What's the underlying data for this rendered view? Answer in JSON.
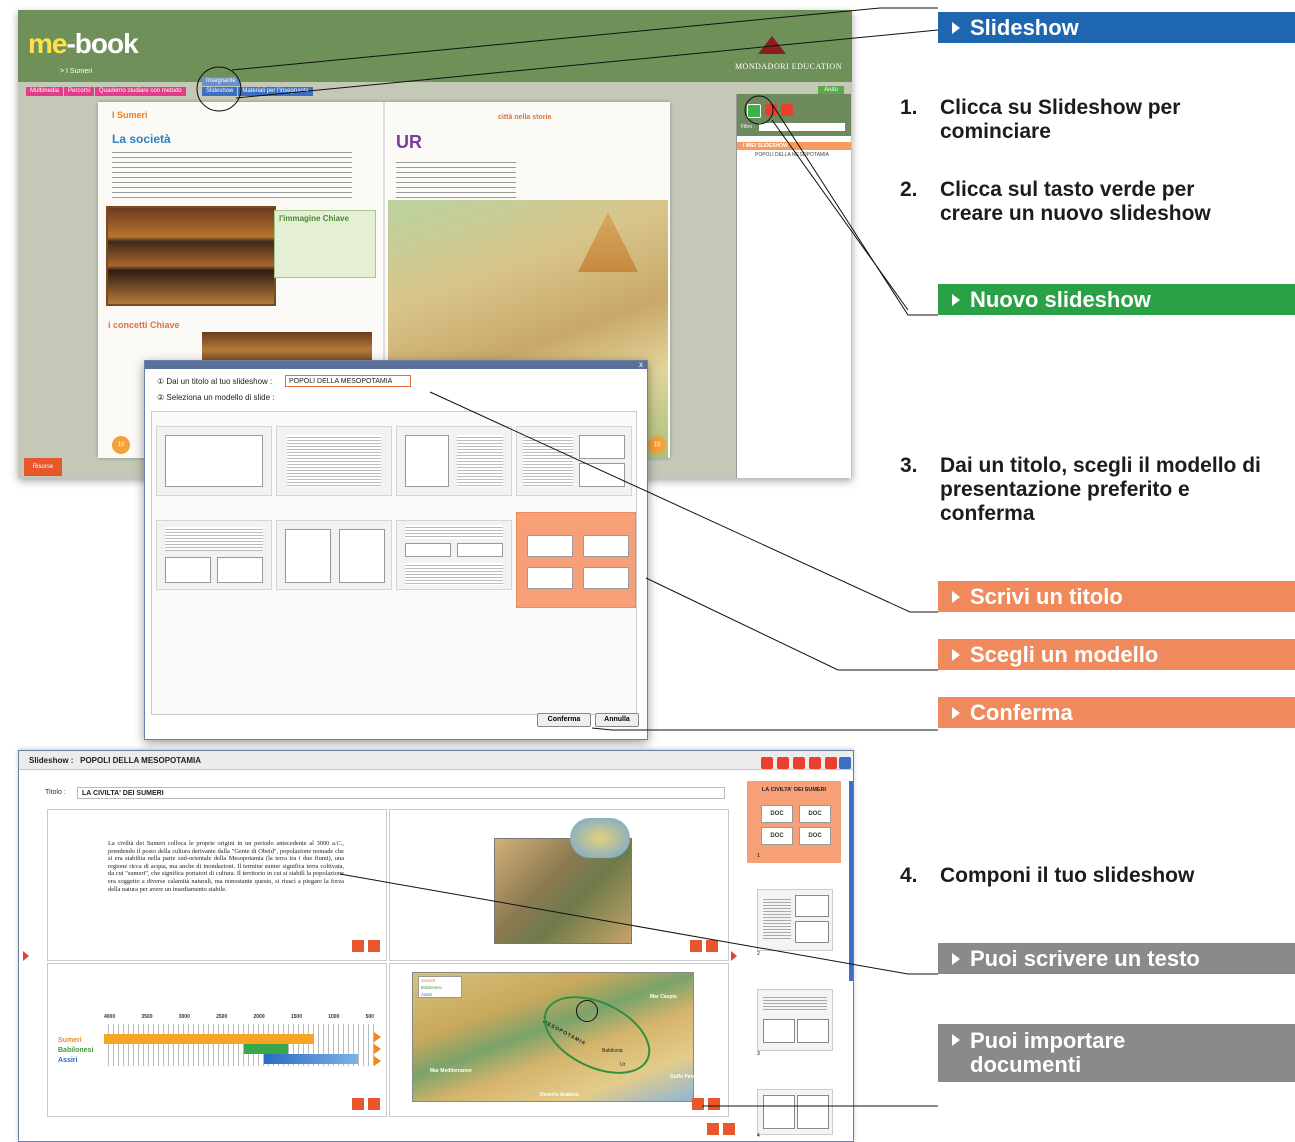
{
  "mebook": {
    "logo_me": "me",
    "logo_book": "-book",
    "breadcrumb": "> I Sumeri",
    "publisher": "MONDADORI EDUCATION",
    "tabs": [
      "Multimedia",
      "Percorsi",
      "Quaderno studiare con metodo"
    ],
    "teacher_label": "Insegnante",
    "slideshow_tab": "Slideshow",
    "materials_tab": "Materiali per l'insegnante",
    "help": "Aiuto",
    "resources": "Risorse",
    "book": {
      "chapter": "I Sumeri",
      "section_left": "La società",
      "section_right": "città nella storia",
      "heading_right": "UR",
      "key_image": "l'immagine Chiave",
      "key_concepts": "i concetti Chiave",
      "page_left": "18",
      "page_right": "19"
    },
    "panel": {
      "filter_label": "Filtro :",
      "folder": "I MIEI SLIDESHOW",
      "item": "POPOLI DELLA MESOPOTAMIA"
    }
  },
  "dialog": {
    "step1_label": "Dai un titolo al tuo slideshow :",
    "step1_num": "①",
    "title_value": "POPOLI DELLA MESOPOTAMIA",
    "step2_label": "Seleziona un modello di slide :",
    "step2_num": "②",
    "confirm": "Conferma",
    "cancel": "Annulla",
    "close": "x"
  },
  "slides": {
    "header_label": "Slideshow :",
    "header_title": "POPOLI DELLA MESOPOTAMIA",
    "title_label": "Titolo :",
    "title_value": "LA CIVILTA' DEI SUMERI",
    "text_block": "La civiltà dei Sumeri colloca le proprie origini in un periodo antecedente al 3000 a.C., prendendo il posto della cultura derivante dalla \"Gente di Obeid\", popolazione nomade che si era stabilita nella parte sud-orientale della Mesopotamia (la terra tra i due fiumi), una regione ricca di acqua, ma anche di inondazioni. Il termine sumer significa terra coltivata, da cui \"sumeri\", che significa portatori di cultura. Il territorio in cui si stabilì la popolazione era soggetto a diverse calamità naturali, ma nonostante questo, si riuscì a piegare la forza della natura per avere un insediamento stabile.",
    "timeline_labels": [
      "Sumeri",
      "Babilonesi",
      "Assiri"
    ],
    "timeline_ticks": [
      "4000",
      "3500",
      "3000",
      "2500",
      "2000",
      "1500",
      "1000",
      "500"
    ],
    "map_legend": [
      "Sumeri",
      "Babilonesi",
      "Assiri"
    ],
    "map_places": [
      "Mar Caspio",
      "Mar Mediterraneo",
      "Deserto Arabico",
      "Golfo Persico",
      "Babilonia",
      "Ur",
      "MESOPOTAMIA"
    ],
    "thumb_title": "LA CIVILTA' DEI SUMERI",
    "doc": "DOC",
    "thumb_numbers": [
      "1",
      "2",
      "3",
      "4"
    ]
  },
  "guide": {
    "banner_slideshow": "Slideshow",
    "step1_num": "1.",
    "step1": "Clicca su Slideshow per cominciare",
    "step2_num": "2.",
    "step2": "Clicca sul tasto verde per creare un nuovo slideshow",
    "banner_new": "Nuovo slideshow",
    "step3_num": "3.",
    "step3": "Dai un titolo, scegli il modello di presentazione preferito e conferma",
    "banner_title": "Scrivi un titolo",
    "banner_model": "Scegli un modello",
    "banner_confirm": "Conferma",
    "step4_num": "4.",
    "step4": "Componi il tuo slideshow",
    "banner_text": "Puoi scrivere un testo",
    "banner_import": "Puoi importare documenti"
  },
  "colors": {
    "blue": "#1f66b1",
    "green": "#2aa147",
    "orange": "#f08a5d",
    "gray": "#8a8a8a",
    "mebook_green": "#6f9159"
  }
}
